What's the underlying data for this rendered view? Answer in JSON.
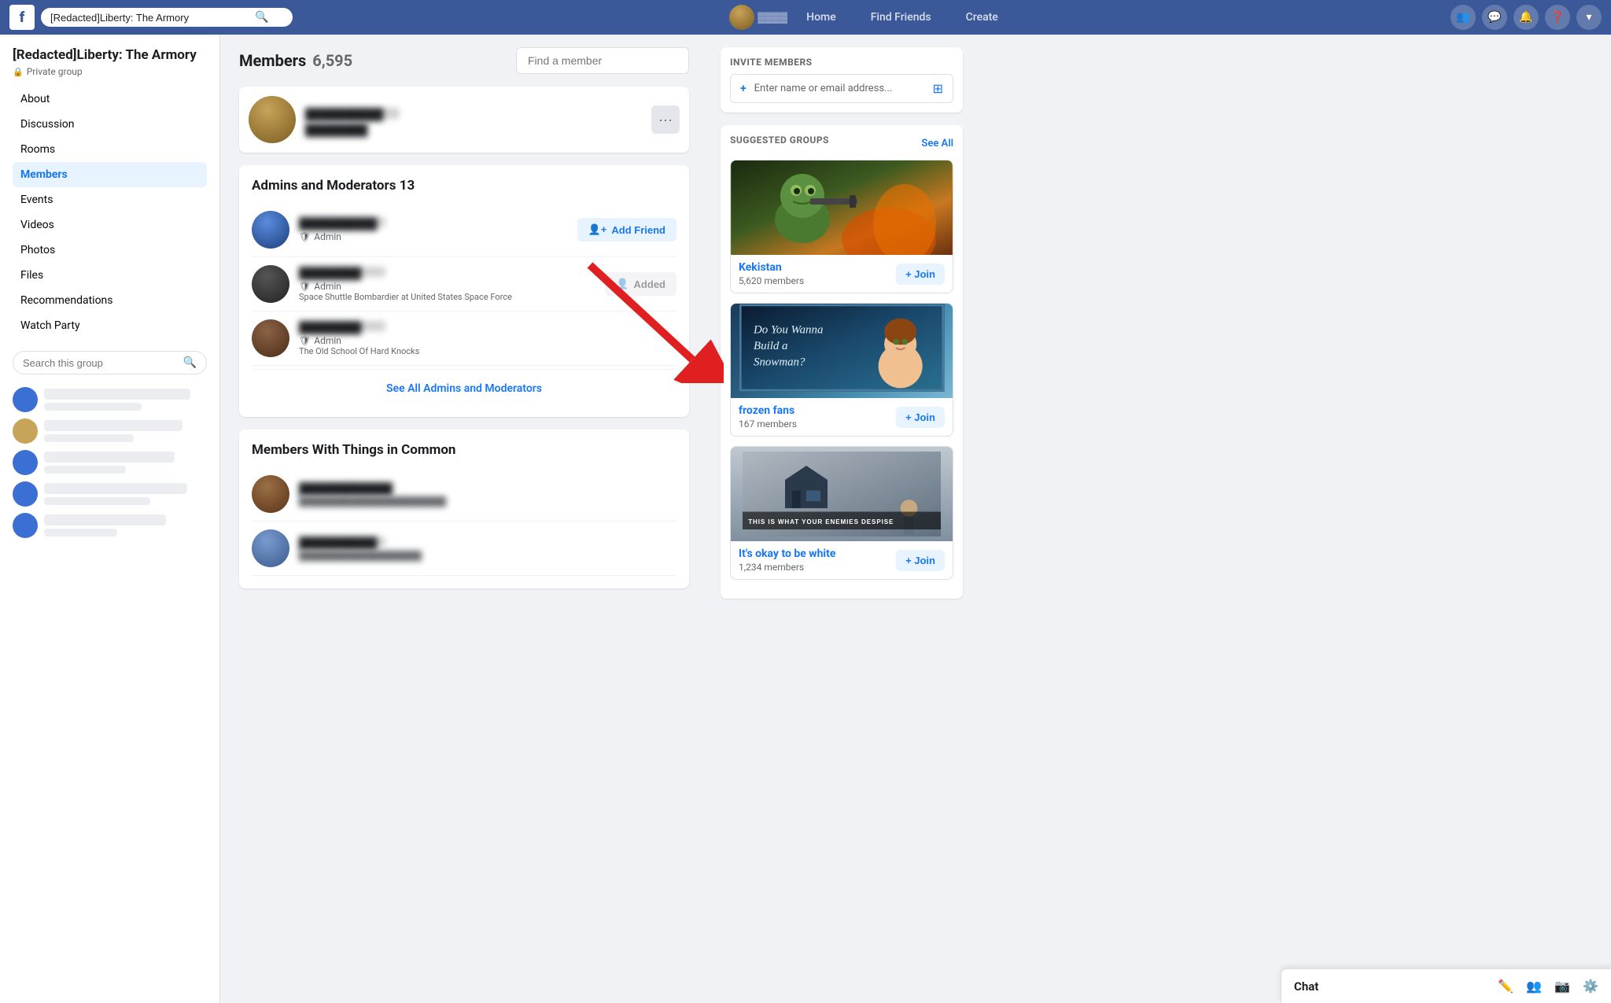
{
  "topnav": {
    "logo": "f",
    "search_value": "[Redacted]Liberty: The Armory",
    "nav_items": [
      "Home",
      "Find Friends",
      "Create"
    ],
    "search_icon": "🔍"
  },
  "left_sidebar": {
    "group_name": "[Redacted]Liberty: The Armory",
    "private_label": "Private group",
    "nav_items": [
      {
        "label": "About",
        "active": false
      },
      {
        "label": "Discussion",
        "active": false
      },
      {
        "label": "Rooms",
        "active": false
      },
      {
        "label": "Members",
        "active": true
      },
      {
        "label": "Events",
        "active": false
      },
      {
        "label": "Videos",
        "active": false
      },
      {
        "label": "Photos",
        "active": false
      },
      {
        "label": "Files",
        "active": false
      },
      {
        "label": "Recommendations",
        "active": false
      },
      {
        "label": "Watch Party",
        "active": false
      }
    ],
    "search_placeholder": "Search this group"
  },
  "main": {
    "members_title": "Members",
    "members_count": "6,595",
    "find_placeholder": "Find a member",
    "admins_section_title": "Admins and Moderators",
    "admins_count": "13",
    "admin_role_label": "Admin",
    "admins": [
      {
        "role": "Admin",
        "add_label": "Add Friend"
      },
      {
        "role": "Admin",
        "subtitle": "Space Shuttle Bombardier at United States Space Force"
      },
      {
        "role": "Admin",
        "subtitle": "The Old School Of Hard Knocks"
      }
    ],
    "see_all_label": "See All Admins and Moderators",
    "members_common_title": "Members With Things in Common"
  },
  "right_sidebar": {
    "invite_section_label": "INVITE MEMBERS",
    "invite_placeholder": "Enter name or email address...",
    "suggested_label": "SUGGESTED GROUPS",
    "see_all_label": "See All",
    "suggested_groups": [
      {
        "name": "Kekistan",
        "members": "5,620 members",
        "join_label": "+ Join"
      },
      {
        "name": "frozen fans",
        "members": "167 members",
        "join_label": "+ Join",
        "image_text": "Do You Wanna Build a Snowman?"
      },
      {
        "name": "It's okay to be white",
        "members": "1,234 members",
        "join_label": "+ Join",
        "image_text": "THIS IS WHAT YOUR ENEMIES DESPISE"
      }
    ]
  },
  "chat_bar": {
    "label": "Chat",
    "icons": [
      "edit",
      "group",
      "gear",
      "settings"
    ]
  }
}
